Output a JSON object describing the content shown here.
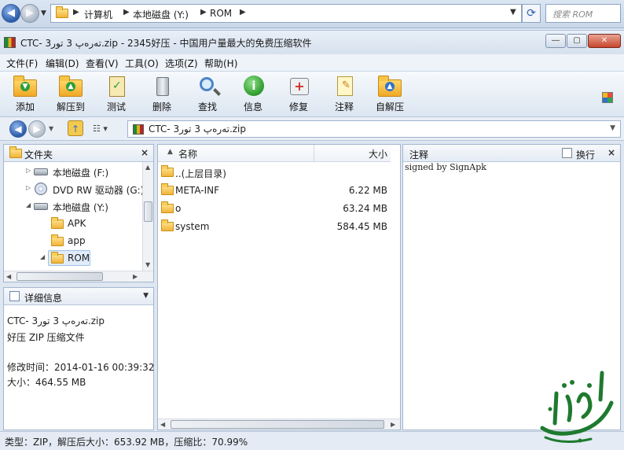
{
  "explorer": {
    "crumbs": [
      "计算机",
      "本地磁盘 (Y:)",
      "ROM"
    ],
    "search_placeholder": "搜索 ROM"
  },
  "window": {
    "title": "CTC- تەرەپ  3 تور3.zip - 2345好压 - 中国用户量最大的免费压缩软件",
    "buttons": [
      "―",
      "▢",
      "✕"
    ]
  },
  "menu": [
    {
      "label": "文件(F)"
    },
    {
      "label": "编辑(D)"
    },
    {
      "label": "查看(V)"
    },
    {
      "label": "工具(O)"
    },
    {
      "label": "选项(Z)"
    },
    {
      "label": "帮助(H)"
    }
  ],
  "toolbar": [
    {
      "label": "添加",
      "icon": "add-icon"
    },
    {
      "label": "解压到",
      "icon": "extract-icon"
    },
    {
      "label": "测试",
      "icon": "test-icon"
    },
    {
      "label": "删除",
      "icon": "delete-icon"
    },
    {
      "label": "查找",
      "icon": "find-icon"
    },
    {
      "label": "信息",
      "icon": "info-icon"
    },
    {
      "label": "修复",
      "icon": "repair-icon"
    },
    {
      "label": "注释",
      "icon": "comment-icon"
    },
    {
      "label": "自解压",
      "icon": "sfx-icon"
    }
  ],
  "pathbar": {
    "path": "CTC- تەرەپ  3 تور3.zip"
  },
  "folders_panel": {
    "title": "文件夹",
    "items": [
      {
        "label": "本地磁盘 (F:)",
        "kind": "drive"
      },
      {
        "label": "DVD RW 驱动器 (G:)",
        "kind": "dvd"
      },
      {
        "label": "本地磁盘 (Y:)",
        "kind": "drive"
      },
      {
        "label": "APK",
        "kind": "folder"
      },
      {
        "label": "app",
        "kind": "folder"
      },
      {
        "label": "ROM",
        "kind": "folder",
        "selected": true
      }
    ]
  },
  "details_panel": {
    "title": "详细信息",
    "filename": "CTC- تەرەپ  3 تور3.zip",
    "filetype": "好压 ZIP 压缩文件",
    "modified": "修改时间：2014-01-16 00:39:32",
    "size": "大小：464.55 MB"
  },
  "file_list": {
    "col_name": "名称",
    "col_size": "大小",
    "rows": [
      {
        "name": "..(上层目录)",
        "size": ""
      },
      {
        "name": "META-INF",
        "size": "6.22 MB"
      },
      {
        "name": "o",
        "size": "63.24 MB"
      },
      {
        "name": "system",
        "size": "584.45 MB"
      }
    ]
  },
  "comment_panel": {
    "title": "注释",
    "wrap_label": "换行",
    "text": "signed by SignApk"
  },
  "status": {
    "text": "类型：ZIP，解压后大小：653.92 MB，压缩比：70.99%"
  },
  "colors": {
    "accent": "#2c5aa8",
    "folder": "#f2b43a",
    "watermark_green": "#1e7a2e"
  }
}
